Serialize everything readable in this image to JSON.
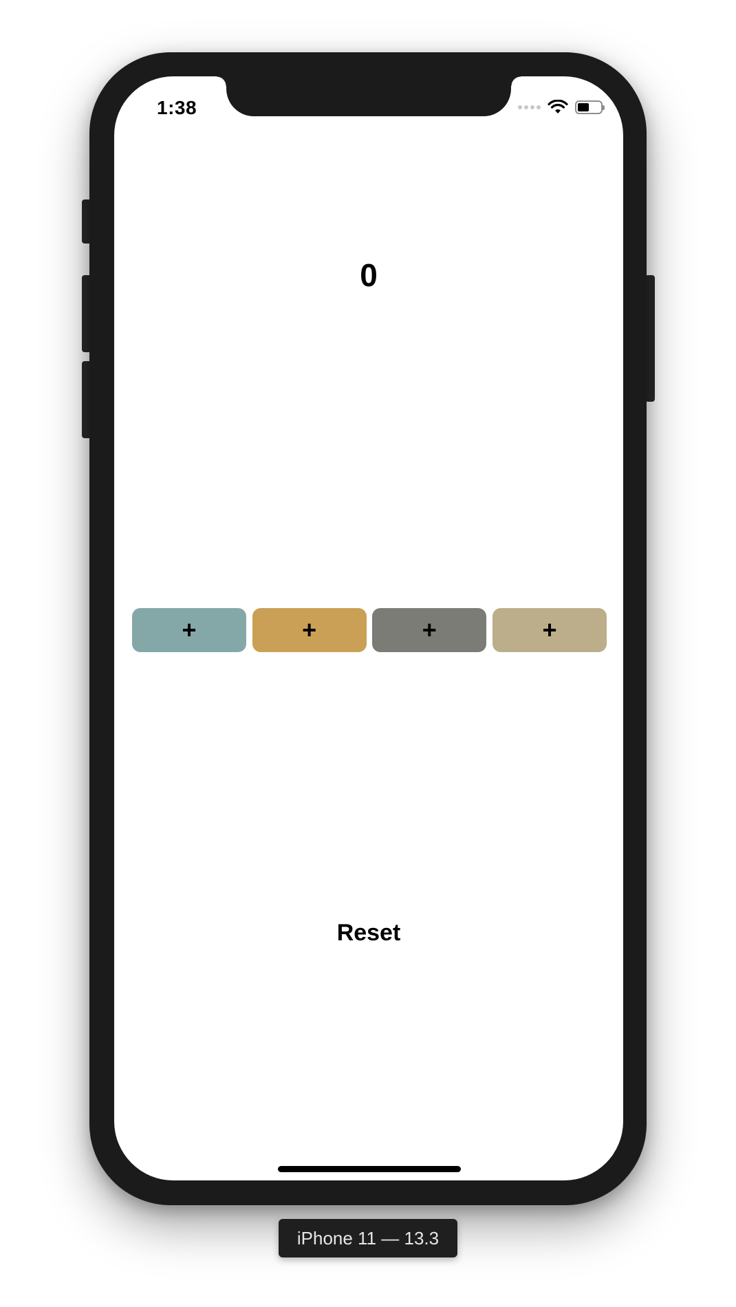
{
  "status_bar": {
    "time": "1:38",
    "battery_level": 0.5
  },
  "counter": {
    "value": "0"
  },
  "add_buttons": [
    {
      "label": "+",
      "color": "#84a8a7"
    },
    {
      "label": "+",
      "color": "#c9a055"
    },
    {
      "label": "+",
      "color": "#7c7c76"
    },
    {
      "label": "+",
      "color": "#bcae8a"
    }
  ],
  "reset_label": "Reset",
  "device_label": "iPhone 11 — 13.3"
}
